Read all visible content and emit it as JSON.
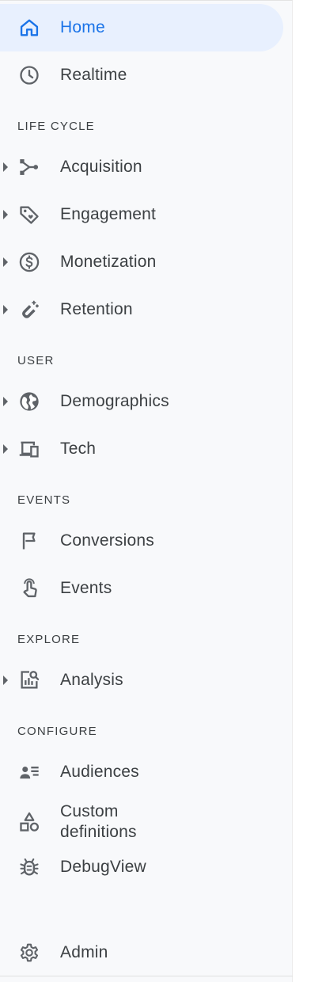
{
  "nav": {
    "home": "Home",
    "realtime": "Realtime",
    "sections": {
      "lifecycle": "LIFE CYCLE",
      "user": "USER",
      "events": "EVENTS",
      "explore": "EXPLORE",
      "configure": "CONFIGURE"
    },
    "lifecycle_items": [
      "Acquisition",
      "Engagement",
      "Monetization",
      "Retention"
    ],
    "user_items": [
      "Demographics",
      "Tech"
    ],
    "events_items": [
      "Conversions",
      "Events"
    ],
    "explore_items": [
      "Analysis"
    ],
    "configure_items": [
      "Audiences",
      "Custom",
      "definitions",
      "DebugView"
    ],
    "admin": "Admin"
  },
  "icons": {
    "home": "home-icon",
    "realtime": "clock-icon",
    "acquisition": "branch-icon",
    "engagement": "tag-icon",
    "monetization": "dollar-icon",
    "retention": "magnet-icon",
    "demographics": "globe-icon",
    "tech": "devices-icon",
    "conversions": "flag-icon",
    "events": "touch-icon",
    "analysis": "analysis-icon",
    "audiences": "audience-icon",
    "custom_definitions": "shapes-icon",
    "debugview": "bug-icon",
    "admin": "gear-icon"
  },
  "colors": {
    "accent": "#1a73e8",
    "active_bg": "#e8f0fe",
    "text": "#3c4043",
    "sidebar_bg": "#f8f9fb"
  }
}
